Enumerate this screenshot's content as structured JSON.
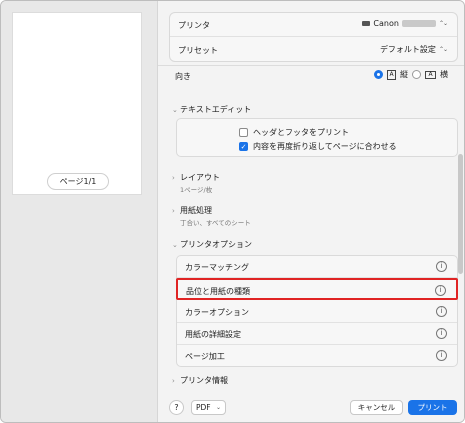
{
  "preview": {
    "page_indicator": "ページ1/1"
  },
  "header": {
    "printer_label": "プリンタ",
    "printer_value": "Canon",
    "preset_label": "プリセット",
    "preset_value": "デフォルト設定"
  },
  "orientation": {
    "label": "向き",
    "portrait_label": "縦",
    "landscape_label": "横",
    "selected": "portrait"
  },
  "text_edit": {
    "title": "テキストエディット",
    "options": [
      {
        "label": "ヘッダとフッタをプリント",
        "checked": false
      },
      {
        "label": "内容を再度折り返してページに合わせる",
        "checked": true
      }
    ]
  },
  "layout": {
    "title": "レイアウト",
    "subtitle": "1ページ/枚"
  },
  "paper_handling": {
    "title": "用紙処理",
    "subtitle": "丁合い、すべてのシート"
  },
  "printer_options": {
    "title": "プリンタオプション",
    "items": [
      {
        "label": "カラーマッチング"
      },
      {
        "label": "品位と用紙の種類",
        "highlighted": true
      },
      {
        "label": "カラーオプション"
      },
      {
        "label": "用紙の詳細設定"
      },
      {
        "label": "ページ加工"
      }
    ]
  },
  "printer_info": {
    "title": "プリンタ情報"
  },
  "footer": {
    "help_label": "?",
    "pdf_label": "PDF",
    "cancel_label": "キャンセル",
    "print_label": "プリント"
  },
  "colors": {
    "accent": "#1a73e8",
    "highlight": "#e02424"
  }
}
